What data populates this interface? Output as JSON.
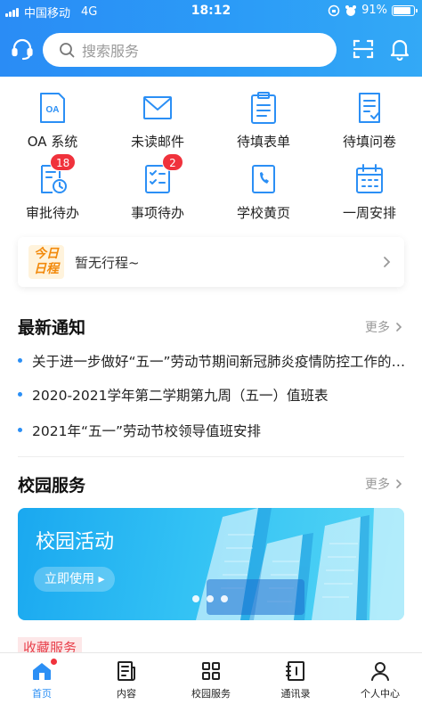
{
  "status_bar": {
    "carrier": "中国移动",
    "network": "4G",
    "time": "18:12",
    "battery": "91%"
  },
  "header": {
    "search_placeholder": "搜索服务"
  },
  "grid": [
    {
      "label": "OA 系统",
      "icon": "oa-icon",
      "badge": ""
    },
    {
      "label": "未读邮件",
      "icon": "mail-icon",
      "badge": ""
    },
    {
      "label": "待填表单",
      "icon": "form-clipboard-icon",
      "badge": ""
    },
    {
      "label": "待填问卷",
      "icon": "survey-icon",
      "badge": ""
    },
    {
      "label": "审批待办",
      "icon": "approval-icon",
      "badge": "18"
    },
    {
      "label": "事项待办",
      "icon": "task-list-icon",
      "badge": "2"
    },
    {
      "label": "学校黄页",
      "icon": "phone-book-icon",
      "badge": ""
    },
    {
      "label": "一周安排",
      "icon": "calendar-icon",
      "badge": ""
    }
  ],
  "schedule": {
    "tag_line1": "今日",
    "tag_line2": "日程",
    "text": "暂无行程~"
  },
  "notices": {
    "title": "最新通知",
    "more": "更多",
    "items": [
      "关于进一步做好“五一”劳动节期间新冠肺炎疫情防控工作的通知",
      "2020-2021学年第二学期第九周（五一）值班表",
      "2021年“五一”劳动节校领导值班安排"
    ]
  },
  "campus": {
    "title": "校园服务",
    "more": "更多",
    "banner_title": "校园活动",
    "banner_button": "立即使用 ▸"
  },
  "favorites": {
    "title": "收藏服务"
  },
  "tabbar": [
    {
      "label": "首页",
      "icon": "home-icon"
    },
    {
      "label": "内容",
      "icon": "content-icon"
    },
    {
      "label": "校园服务",
      "icon": "apps-grid-icon"
    },
    {
      "label": "通讯录",
      "icon": "contacts-book-icon"
    },
    {
      "label": "个人中心",
      "icon": "user-icon"
    }
  ],
  "colors": {
    "primary": "#2b8ff5",
    "badge": "#f0323c",
    "schedule_tag": "#f28a0c"
  }
}
